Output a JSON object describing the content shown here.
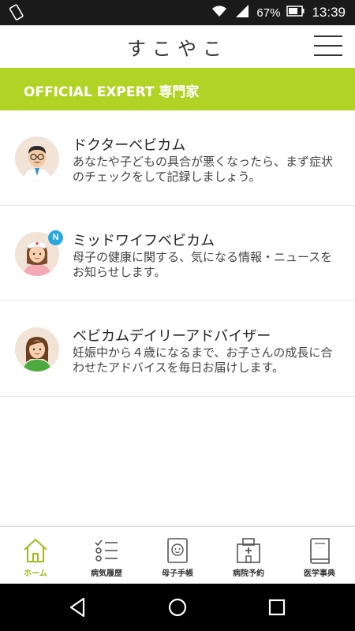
{
  "status_bar": {
    "battery": "67%",
    "time": "13:39"
  },
  "header": {
    "app_title": "すこやこ"
  },
  "section": {
    "title": "OFFICIAL EXPERT 専門家"
  },
  "experts": [
    {
      "name": "ドクターベビカム",
      "description": "あなたや子どもの具合が悪くなったら、まず症状のチェックをして記録しましょう。",
      "badge": ""
    },
    {
      "name": "ミッドワイフベビカム",
      "description": "母子の健康に関する、気になる情報・ニュースをお知らせします。",
      "badge": "N"
    },
    {
      "name": "ベビカムデイリーアドバイザー",
      "description": "妊娠中から４歳になるまで、お子さんの成長に合わせたアドバイスを毎日お届けします。",
      "badge": ""
    }
  ],
  "bottom_nav": {
    "items": [
      {
        "label": "ホーム",
        "icon": "home-icon",
        "active": true
      },
      {
        "label": "病気履歴",
        "icon": "checklist-icon",
        "active": false
      },
      {
        "label": "母子手帳",
        "icon": "baby-book-icon",
        "active": false
      },
      {
        "label": "病院予約",
        "icon": "hospital-icon",
        "active": false
      },
      {
        "label": "医学事典",
        "icon": "book-icon",
        "active": false
      }
    ]
  },
  "colors": {
    "accent": "#b1d326",
    "active_nav": "#9cbd1a",
    "badge": "#29a7e1"
  }
}
